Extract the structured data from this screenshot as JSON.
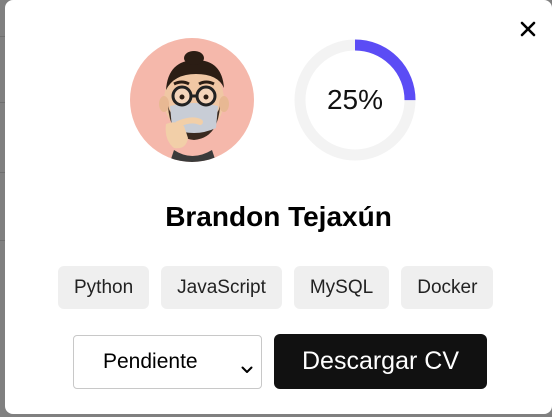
{
  "modal": {
    "close_label": "Close",
    "profile": {
      "name": "Brandon Tejaxún",
      "avatar_icon": "memoji-thinking-avatar",
      "avatar_bg": "#f5b8ab"
    },
    "progress": {
      "value": 25,
      "label": "25%",
      "color": "#5b4cf5",
      "track_color": "#f3f3f3"
    },
    "skills": [
      "Python",
      "JavaScript",
      "MySQL",
      "Docker"
    ],
    "status_select": {
      "selected": "Pendiente"
    },
    "download_label": "Descargar CV"
  }
}
